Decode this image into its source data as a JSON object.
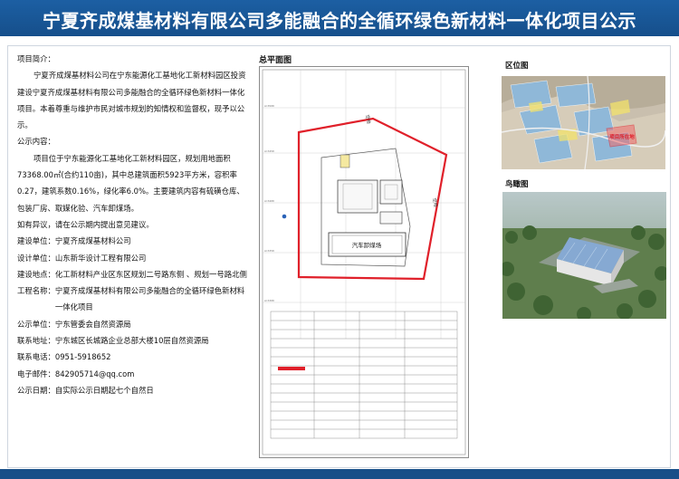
{
  "banner": {
    "title": "宁夏齐成煤基材料有限公司多能融合的全循环绿色新材料一体化项目公示"
  },
  "intro": {
    "heading": "项目简介：",
    "summary": "宁夏齐成煤基材料公司在宁东能源化工基地化工新材料园区投资建设宁夏齐成煤基材料有限公司多能融合的全循环绿色新材料一体化项目。本着尊重与维护市民对城市规划的知情权和监督权，现予以公示。",
    "content_heading": "公示内容：",
    "content": "项目位于宁东能源化工基地化工新材料园区，规划用地面积73368.00㎡(合约110亩)，其中总建筑面积5923平方米，容积率0.27，建筑系数0.16%，绿化率6.0%。主要建筑内容有硫磺仓库、包装厂房、取媒化验、汽车卸煤场。",
    "objection": "如有异议，请在公示期内提出意见建议。",
    "fields": [
      {
        "key": "建设单位：",
        "value": "宁夏齐成煤基材料公司"
      },
      {
        "key": "设计单位：",
        "value": "山东新华设计工程有限公司"
      },
      {
        "key": "建设地点：",
        "value": "化工新材料产业区东区规划二号路东侧 、规划一号路北侧"
      },
      {
        "key": "工程名称：",
        "value": "宁夏齐成煤基材料有限公司多能融合的全循环绿色新材料一体化项目"
      },
      {
        "key": "公示单位：",
        "value": "宁东管委会自然资源局"
      },
      {
        "key": "联系地址：",
        "value": "宁东城区长城路企业总部大楼10层自然资源局"
      },
      {
        "key": "联系电话：",
        "value": "0951-5918652"
      },
      {
        "key": "电子邮件：",
        "value": "842905714@qq.com"
      },
      {
        "key": "公示日期：",
        "value": "自实际公示日期起七个自然日"
      }
    ]
  },
  "site_plan": {
    "title": "总平面图",
    "label_top": "空地",
    "label_right": "空地",
    "building_unloading": "汽车卸煤场"
  },
  "location": {
    "title": "区位图",
    "marker": "项目所在地"
  },
  "aerial": {
    "title": "鸟瞰图"
  },
  "colors": {
    "banner": "#1a5a9c",
    "boundary": "#e0202a",
    "footer": "#184f88"
  }
}
